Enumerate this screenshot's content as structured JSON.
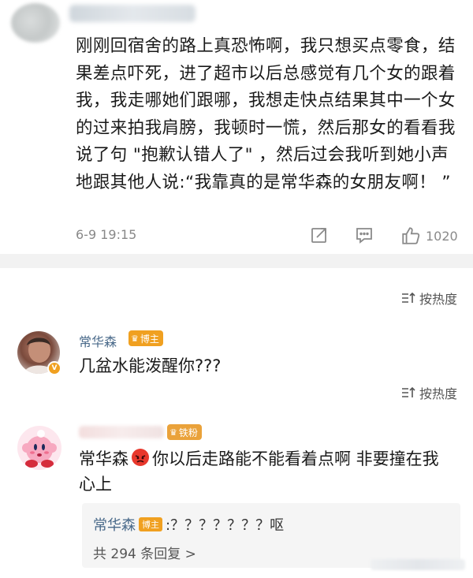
{
  "post": {
    "text": "刚刚回宿舍的路上真恐怖啊，我只想买点零食，结果差点吓死，进了超市以后总感觉有几个女的跟着我，我走哪她们跟哪，我想走快点结果其中一个女的过来拍我肩膀，我顿时一慌，然后那女的看看我说了句 \"抱歉认错人了\" ，然后过会我听到她小声地跟其他人说:“我靠真的是常华森的女朋友啊！ ”",
    "time": "6-9 19:15",
    "like_count": "1020",
    "icons": [
      "share-icon",
      "comment-icon",
      "like-icon"
    ]
  },
  "sort_label_1": "按热度",
  "sort_label_2": "按热度",
  "comment1": {
    "name": "常华森",
    "badge": "博主",
    "text": "几盆水能泼醒你???"
  },
  "comment2": {
    "badge": "铁粉",
    "text_prefix": "常华森",
    "text_suffix": "你以后走路能不能看着点啊 非要撞在我心上",
    "emoji": "angry-face-icon"
  },
  "reply": {
    "name": "常华森",
    "badge": "博主",
    "text": ":？？？？？？？呕",
    "more": "共 294 条回复 >"
  },
  "colors": {
    "name": "#4a6a8a",
    "badge": "#f0a020",
    "muted": "#8a8a8a"
  }
}
